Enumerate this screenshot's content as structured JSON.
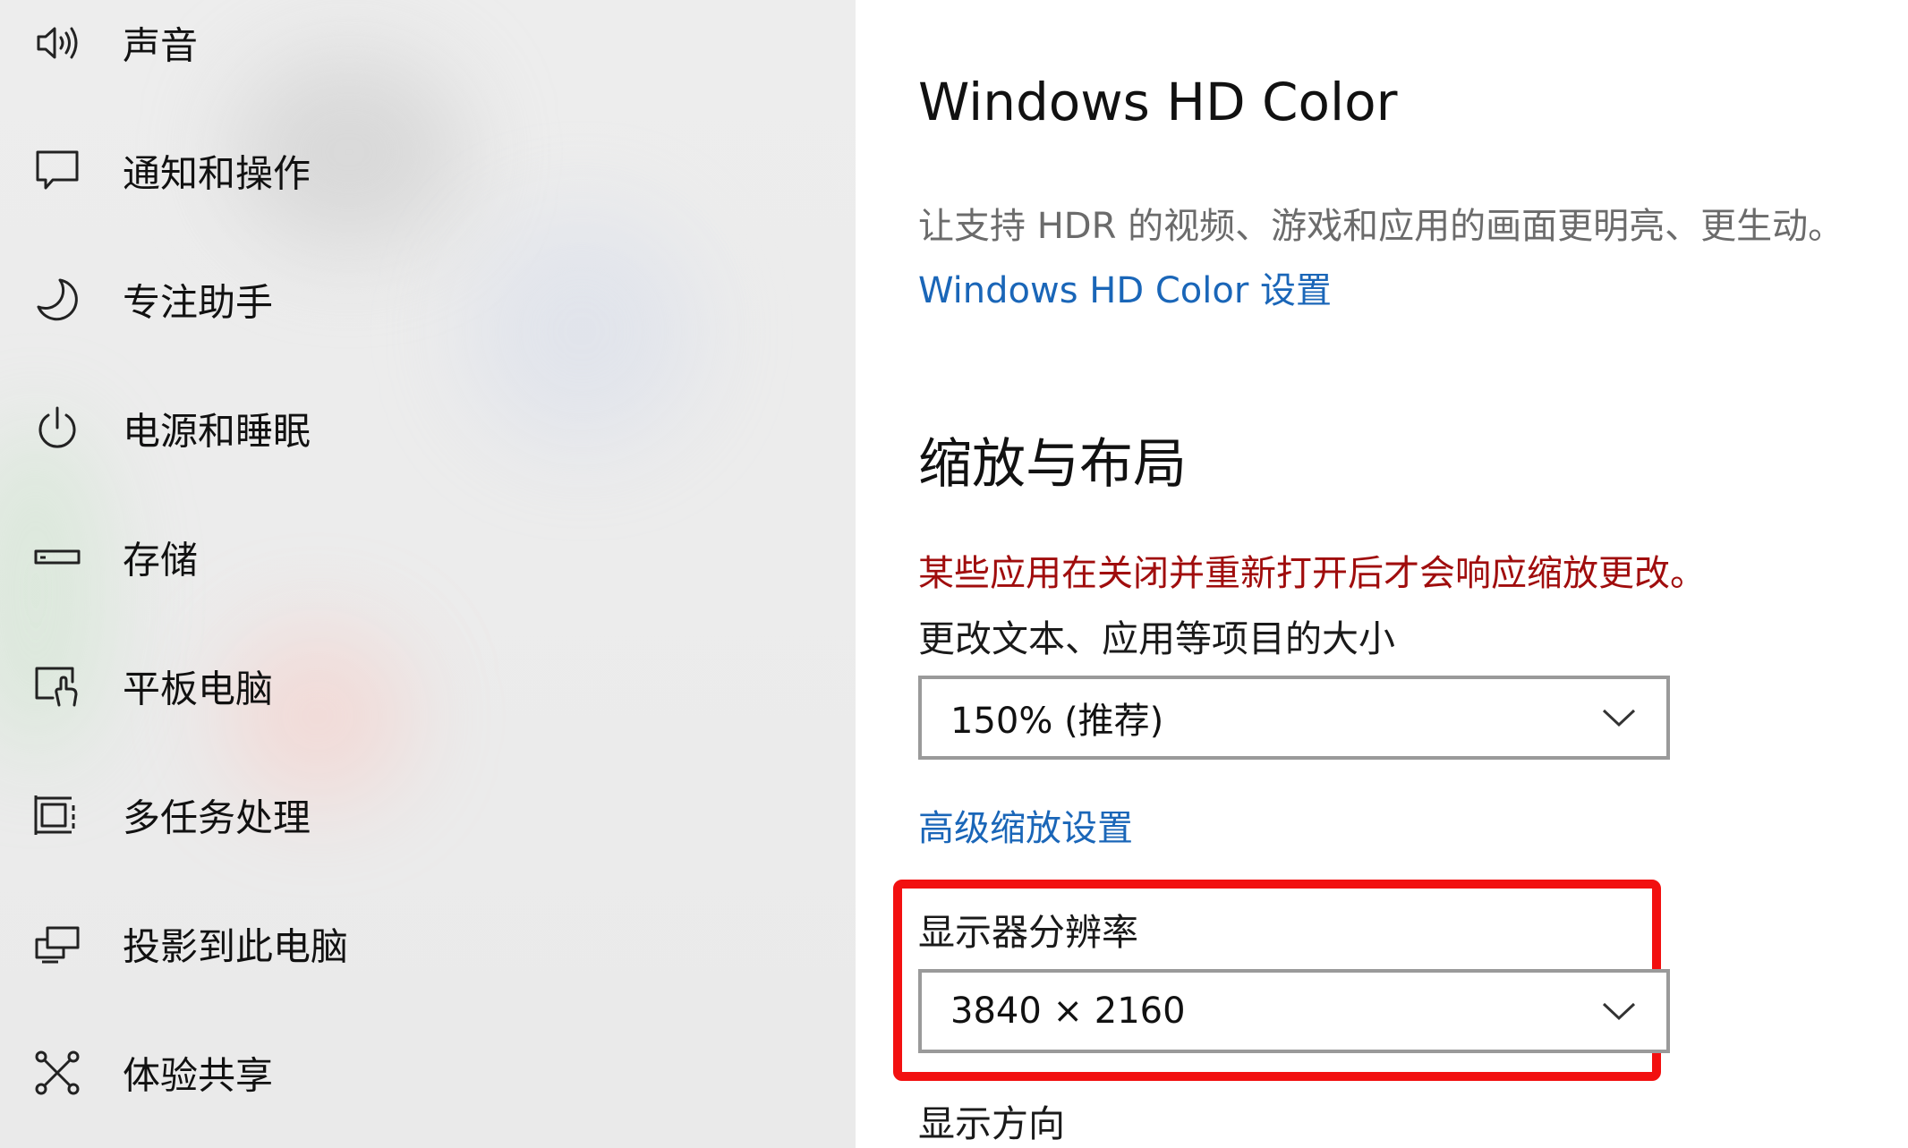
{
  "sidebar": {
    "items": [
      {
        "label": "声音",
        "icon": "speaker-icon"
      },
      {
        "label": "通知和操作",
        "icon": "notification-icon"
      },
      {
        "label": "专注助手",
        "icon": "moon-icon"
      },
      {
        "label": "电源和睡眠",
        "icon": "power-icon"
      },
      {
        "label": "存储",
        "icon": "storage-icon"
      },
      {
        "label": "平板电脑",
        "icon": "tablet-icon"
      },
      {
        "label": "多任务处理",
        "icon": "multitasking-icon"
      },
      {
        "label": "投影到此电脑",
        "icon": "project-icon"
      },
      {
        "label": "体验共享",
        "icon": "share-icon"
      }
    ]
  },
  "hd_color": {
    "title": "Windows HD Color",
    "description": "让支持 HDR 的视频、游戏和应用的画面更明亮、更生动。",
    "settings_link": "Windows HD Color 设置"
  },
  "scale_layout": {
    "title": "缩放与布局",
    "warning": "某些应用在关闭并重新打开后才会响应缩放更改。",
    "text_size_label": "更改文本、应用等项目的大小",
    "text_size_value": "150% (推荐)",
    "advanced_link": "高级缩放设置",
    "resolution_label": "显示器分辨率",
    "resolution_value": "3840 × 2160",
    "orientation_label": "显示方向"
  },
  "colors": {
    "link": "#1a66b8",
    "warning": "#a00d0d",
    "highlight": "#f21010"
  }
}
